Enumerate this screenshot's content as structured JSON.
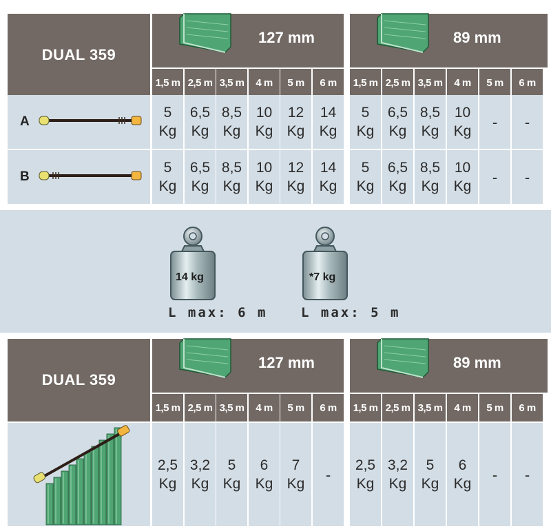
{
  "top_table": {
    "product": "DUAL 359",
    "sizes": [
      "127 mm",
      "89 mm"
    ],
    "lengths": [
      "1,5 m",
      "2,5 m",
      "3,5 m",
      "4 m",
      "5 m",
      "6 m"
    ],
    "unit": "Kg",
    "rows": [
      {
        "label": "A",
        "left": [
          "5",
          "6,5",
          "8,5",
          "10",
          "12",
          "14"
        ],
        "right": [
          "5",
          "6,5",
          "8,5",
          "10",
          "-",
          "-"
        ]
      },
      {
        "label": "B",
        "left": [
          "5",
          "6,5",
          "8,5",
          "10",
          "12",
          "14"
        ],
        "right": [
          "5",
          "6,5",
          "8,5",
          "10",
          "-",
          "-"
        ]
      }
    ]
  },
  "weights": [
    {
      "label": "14 kg",
      "lmax": "L max: 6 m"
    },
    {
      "label": "*7 kg",
      "lmax": "L max: 5 m"
    }
  ],
  "bottom_table": {
    "product": "DUAL 359",
    "sizes": [
      "127 mm",
      "89 mm"
    ],
    "lengths": [
      "1,5 m",
      "2,5 m",
      "3,5 m",
      "4 m",
      "5 m",
      "6 m"
    ],
    "unit": "Kg",
    "left": [
      "2,5",
      "3,2",
      "5",
      "6",
      "7",
      "-"
    ],
    "right": [
      "2,5",
      "3,2",
      "5",
      "6",
      "-",
      "-"
    ]
  },
  "colors": {
    "header": "#726964",
    "body": "#d3dde5",
    "profile": "#4fa573",
    "tip_yellow": "#e8e070",
    "tip_orange": "#f2b53f"
  }
}
